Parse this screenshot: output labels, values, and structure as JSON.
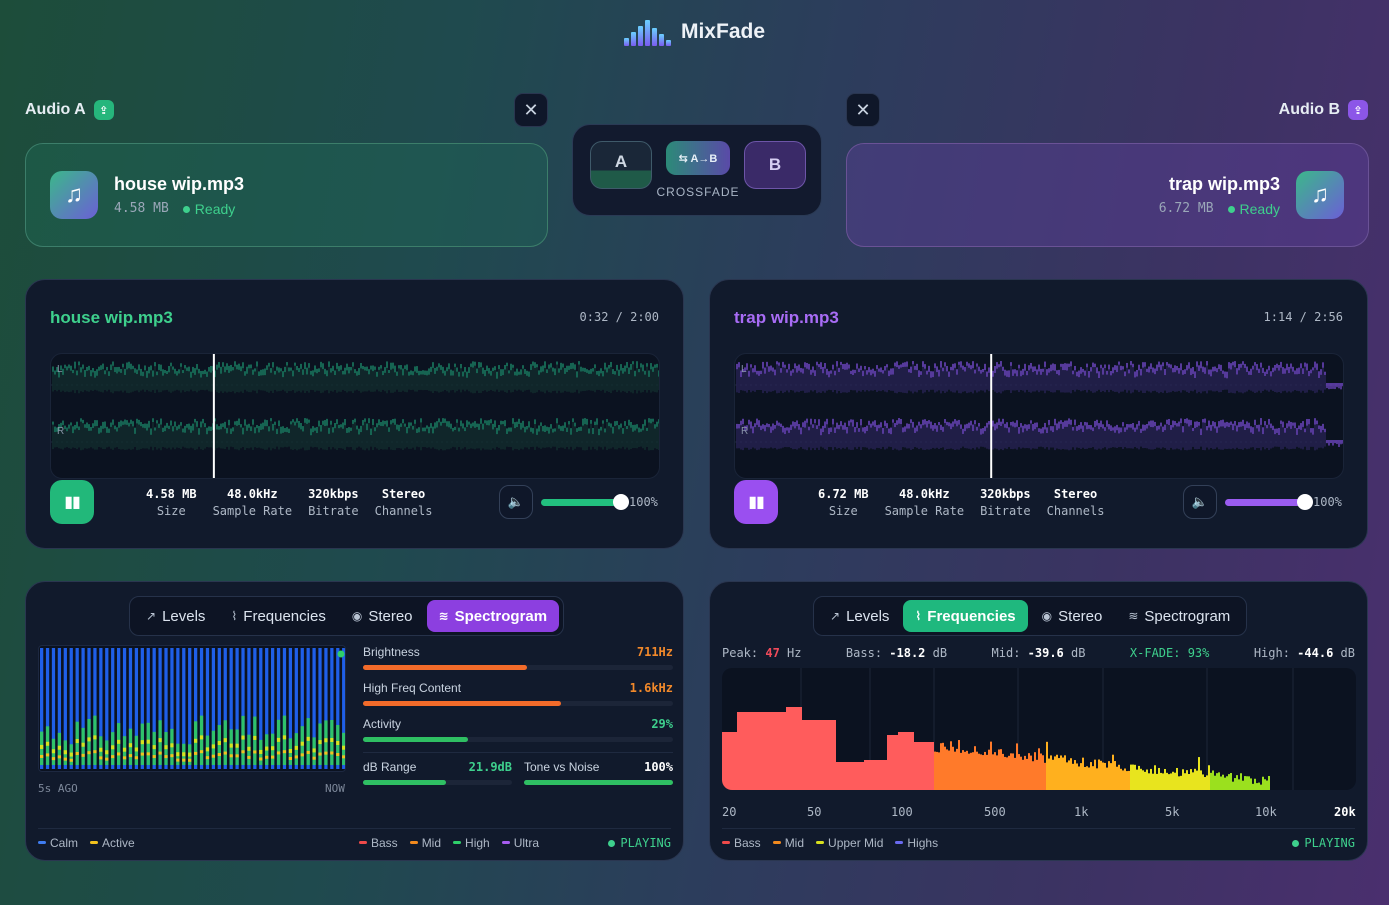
{
  "app": {
    "title": "MixFade"
  },
  "audio_a": {
    "label": "Audio A",
    "file_name": "house wip.mp3",
    "size": "4.58 MB",
    "status": "Ready",
    "time": "0:32 / 2:00",
    "stats": [
      {
        "value": "4.58 MB",
        "key": "Size"
      },
      {
        "value": "48.0kHz",
        "key": "Sample Rate"
      },
      {
        "value": "320kbps",
        "key": "Bitrate"
      },
      {
        "value": "Stereo",
        "key": "Channels"
      }
    ],
    "volume": "100%",
    "volume_level": 1.0,
    "playhead": 0.267,
    "accent": "#3ed08d"
  },
  "audio_b": {
    "label": "Audio B",
    "file_name": "trap wip.mp3",
    "size": "6.72 MB",
    "status": "Ready",
    "time": "1:14 / 2:56",
    "stats": [
      {
        "value": "6.72 MB",
        "key": "Size"
      },
      {
        "value": "48.0kHz",
        "key": "Sample Rate"
      },
      {
        "value": "320kbps",
        "key": "Bitrate"
      },
      {
        "value": "Stereo",
        "key": "Channels"
      }
    ],
    "volume": "100%",
    "volume_level": 1.0,
    "playhead": 0.42,
    "accent": "#9a5cf0"
  },
  "crossfade": {
    "a": "A",
    "b": "B",
    "mid": "⇆ A→B",
    "label": "CROSSFADE"
  },
  "channels": {
    "left": "L",
    "right": "R"
  },
  "analyzer_a": {
    "tabs": [
      "Levels",
      "Frequencies",
      "Stereo",
      "Spectrogram"
    ],
    "active_tab": "Spectrogram",
    "time_left": "5s AGO",
    "time_right": "NOW",
    "metrics": [
      {
        "name": "Brightness",
        "value": "711Hz",
        "fill": 0.53,
        "color": "#f26b2a"
      },
      {
        "name": "High Freq Content",
        "value": "1.6kHz",
        "fill": 0.64,
        "color": "#f26b2a"
      },
      {
        "name": "Activity",
        "value": "29%",
        "fill": 0.34,
        "color": "#2fbf63"
      }
    ],
    "db_range": {
      "name": "dB Range",
      "value": "21.9dB",
      "fill": 0.56
    },
    "tone_noise": {
      "name": "Tone vs Noise",
      "value": "100%",
      "fill": 1.0
    },
    "legend_left": [
      {
        "name": "Calm",
        "color": "#3f7cf0"
      },
      {
        "name": "Active",
        "color": "#f2c21e"
      }
    ],
    "legend_right": [
      {
        "name": "Bass",
        "color": "#ef4a4a"
      },
      {
        "name": "Mid",
        "color": "#f28a1e"
      },
      {
        "name": "High",
        "color": "#2fcf6a"
      },
      {
        "name": "Ultra",
        "color": "#a65cf0"
      }
    ],
    "status": "PLAYING"
  },
  "analyzer_b": {
    "tabs": [
      "Levels",
      "Frequencies",
      "Stereo",
      "Spectrogram"
    ],
    "active_tab": "Frequencies",
    "peak_label": "Peak:",
    "peak_value": "47",
    "peak_unit": "Hz",
    "bass_label": "Bass:",
    "bass_value": "-18.2",
    "bass_unit": "dB",
    "mid_label": "Mid:",
    "mid_value": "-39.6",
    "mid_unit": "dB",
    "xfade_label": "X-FADE:",
    "xfade_value": "93%",
    "high_label": "High:",
    "high_value": "-44.6",
    "high_unit": "dB",
    "freq_ticks": [
      "20",
      "50",
      "100",
      "500",
      "1k",
      "5k",
      "10k",
      "20k"
    ],
    "legend": [
      {
        "name": "Bass",
        "color": "#ef4a4a"
      },
      {
        "name": "Mid",
        "color": "#f28a1e"
      },
      {
        "name": "Upper Mid",
        "color": "#d8e01e"
      },
      {
        "name": "Highs",
        "color": "#6a6af0"
      }
    ],
    "status": "PLAYING"
  }
}
